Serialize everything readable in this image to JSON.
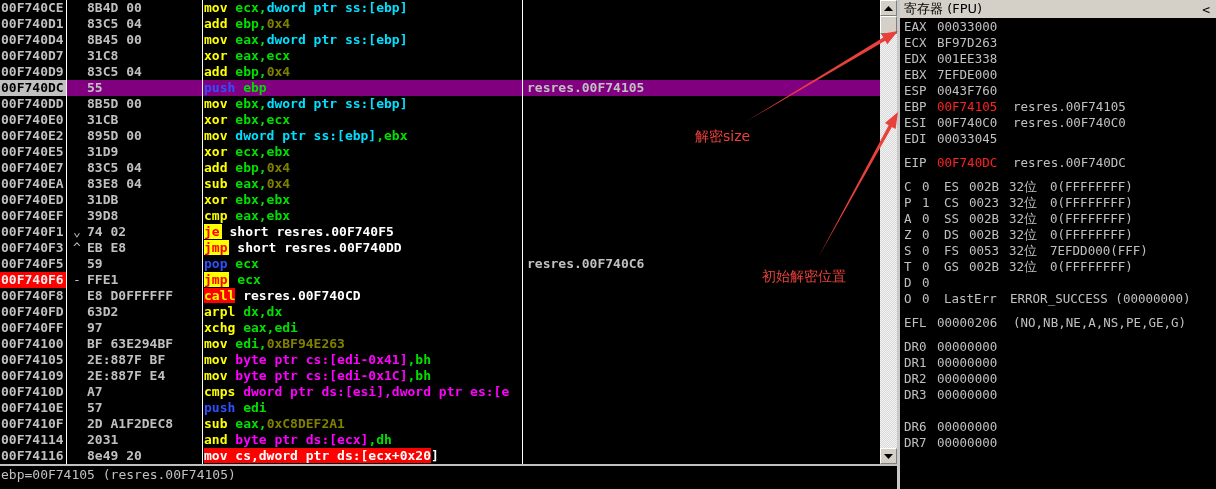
{
  "disassembly": {
    "rows": [
      {
        "address": "00F740CE",
        "jump_mark": "",
        "hex": "8B4D 00",
        "tokens": [
          {
            "kind": "mnemonic",
            "text": "mov"
          },
          {
            "kind": "register",
            "text": "ecx,"
          },
          {
            "kind": "stack_memory",
            "text": "dword ptr ss:[ebp]"
          }
        ],
        "comment": "",
        "selected": false,
        "breakpoint": false
      },
      {
        "address": "00F740D1",
        "jump_mark": "",
        "hex": "83C5 04",
        "tokens": [
          {
            "kind": "mnemonic",
            "text": "add"
          },
          {
            "kind": "register",
            "text": "ebp,"
          },
          {
            "kind": "constant",
            "text": "0x4"
          }
        ],
        "comment": "",
        "selected": false,
        "breakpoint": false
      },
      {
        "address": "00F740D4",
        "jump_mark": "",
        "hex": "8B45 00",
        "tokens": [
          {
            "kind": "mnemonic",
            "text": "mov"
          },
          {
            "kind": "register",
            "text": "eax,"
          },
          {
            "kind": "stack_memory",
            "text": "dword ptr ss:[ebp]"
          }
        ],
        "comment": "",
        "selected": false,
        "breakpoint": false
      },
      {
        "address": "00F740D7",
        "jump_mark": "",
        "hex": "31C8",
        "tokens": [
          {
            "kind": "mnemonic",
            "text": "xor"
          },
          {
            "kind": "register",
            "text": "eax,ecx"
          }
        ],
        "comment": "",
        "selected": false,
        "breakpoint": false
      },
      {
        "address": "00F740D9",
        "jump_mark": "",
        "hex": "83C5 04",
        "tokens": [
          {
            "kind": "mnemonic",
            "text": "add"
          },
          {
            "kind": "register",
            "text": "ebp,"
          },
          {
            "kind": "constant",
            "text": "0x4"
          }
        ],
        "comment": "",
        "selected": false,
        "breakpoint": false
      },
      {
        "address": "00F740DC",
        "jump_mark": "",
        "hex": "55",
        "tokens": [
          {
            "kind": "stack_op",
            "text": "push"
          },
          {
            "kind": "register",
            "text": "ebp"
          }
        ],
        "comment": "resres.00F74105",
        "selected": true,
        "breakpoint": false
      },
      {
        "address": "00F740DD",
        "jump_mark": "",
        "hex": "8B5D 00",
        "tokens": [
          {
            "kind": "mnemonic",
            "text": "mov"
          },
          {
            "kind": "register",
            "text": "ebx,"
          },
          {
            "kind": "stack_memory",
            "text": "dword ptr ss:[ebp]"
          }
        ],
        "comment": "",
        "selected": false,
        "breakpoint": false
      },
      {
        "address": "00F740E0",
        "jump_mark": "",
        "hex": "31CB",
        "tokens": [
          {
            "kind": "mnemonic",
            "text": "xor"
          },
          {
            "kind": "register",
            "text": "ebx,ecx"
          }
        ],
        "comment": "",
        "selected": false,
        "breakpoint": false
      },
      {
        "address": "00F740E2",
        "jump_mark": "",
        "hex": "895D 00",
        "tokens": [
          {
            "kind": "mnemonic",
            "text": "mov"
          },
          {
            "kind": "stack_memory",
            "text": "dword ptr ss:[ebp]"
          },
          {
            "kind": "register",
            "text": ",ebx"
          }
        ],
        "comment": "",
        "selected": false,
        "breakpoint": false
      },
      {
        "address": "00F740E5",
        "jump_mark": "",
        "hex": "31D9",
        "tokens": [
          {
            "kind": "mnemonic",
            "text": "xor"
          },
          {
            "kind": "register",
            "text": "ecx,ebx"
          }
        ],
        "comment": "",
        "selected": false,
        "breakpoint": false
      },
      {
        "address": "00F740E7",
        "jump_mark": "",
        "hex": "83C5 04",
        "tokens": [
          {
            "kind": "mnemonic",
            "text": "add"
          },
          {
            "kind": "register",
            "text": "ebp,"
          },
          {
            "kind": "constant",
            "text": "0x4"
          }
        ],
        "comment": "",
        "selected": false,
        "breakpoint": false
      },
      {
        "address": "00F740EA",
        "jump_mark": "",
        "hex": "83E8 04",
        "tokens": [
          {
            "kind": "mnemonic",
            "text": "sub"
          },
          {
            "kind": "register",
            "text": "eax,"
          },
          {
            "kind": "constant",
            "text": "0x4"
          }
        ],
        "comment": "",
        "selected": false,
        "breakpoint": false
      },
      {
        "address": "00F740ED",
        "jump_mark": "",
        "hex": "31DB",
        "tokens": [
          {
            "kind": "mnemonic",
            "text": "xor"
          },
          {
            "kind": "register",
            "text": "ebx,ebx"
          }
        ],
        "comment": "",
        "selected": false,
        "breakpoint": false
      },
      {
        "address": "00F740EF",
        "jump_mark": "",
        "hex": "39D8",
        "tokens": [
          {
            "kind": "mnemonic",
            "text": "cmp"
          },
          {
            "kind": "register",
            "text": "eax,ebx"
          }
        ],
        "comment": "",
        "selected": false,
        "breakpoint": false
      },
      {
        "address": "00F740F1",
        "jump_mark": "⌄",
        "hex": "74 02",
        "tokens": [
          {
            "kind": "jump",
            "text": "je"
          },
          {
            "kind": "plain",
            "text": "short resres.00F740F5"
          }
        ],
        "comment": "",
        "selected": false,
        "breakpoint": false
      },
      {
        "address": "00F740F3",
        "jump_mark": "^",
        "hex": "EB E8",
        "tokens": [
          {
            "kind": "jump",
            "text": "jmp"
          },
          {
            "kind": "plain",
            "text": "short resres.00F740DD"
          }
        ],
        "comment": "",
        "selected": false,
        "breakpoint": false
      },
      {
        "address": "00F740F5",
        "jump_mark": "",
        "hex": "59",
        "tokens": [
          {
            "kind": "stack_op",
            "text": "pop"
          },
          {
            "kind": "register",
            "text": "ecx"
          }
        ],
        "comment": "resres.00F740C6",
        "selected": false,
        "breakpoint": false
      },
      {
        "address": "00F740F6",
        "jump_mark": "-",
        "hex": "FFE1",
        "tokens": [
          {
            "kind": "jump",
            "text": "jmp"
          },
          {
            "kind": "register",
            "text": "ecx"
          }
        ],
        "comment": "",
        "selected": false,
        "breakpoint": true
      },
      {
        "address": "00F740F8",
        "jump_mark": "",
        "hex": "E8 D0FFFFFF",
        "tokens": [
          {
            "kind": "call",
            "text": "call"
          },
          {
            "kind": "plain",
            "text": "resres.00F740CD"
          }
        ],
        "comment": "",
        "selected": false,
        "breakpoint": false
      },
      {
        "address": "00F740FD",
        "jump_mark": "",
        "hex": "63D2",
        "tokens": [
          {
            "kind": "mnemonic",
            "text": "arpl"
          },
          {
            "kind": "register",
            "text": "dx,dx"
          }
        ],
        "comment": "",
        "selected": false,
        "breakpoint": false
      },
      {
        "address": "00F740FF",
        "jump_mark": "",
        "hex": "97",
        "tokens": [
          {
            "kind": "mnemonic",
            "text": "xchg"
          },
          {
            "kind": "register",
            "text": "eax,edi"
          }
        ],
        "comment": "",
        "selected": false,
        "breakpoint": false
      },
      {
        "address": "00F74100",
        "jump_mark": "",
        "hex": "BF 63E294BF",
        "tokens": [
          {
            "kind": "mnemonic",
            "text": "mov"
          },
          {
            "kind": "register",
            "text": "edi,"
          },
          {
            "kind": "constant",
            "text": "0xBF94E263"
          }
        ],
        "comment": "",
        "selected": false,
        "breakpoint": false
      },
      {
        "address": "00F74105",
        "jump_mark": "",
        "hex": "2E:887F BF",
        "tokens": [
          {
            "kind": "mnemonic",
            "text": "mov"
          },
          {
            "kind": "memory",
            "text": "byte ptr cs:[edi-0x41]"
          },
          {
            "kind": "register",
            "text": ",bh"
          }
        ],
        "comment": "",
        "selected": false,
        "breakpoint": false
      },
      {
        "address": "00F74109",
        "jump_mark": "",
        "hex": "2E:887F E4",
        "tokens": [
          {
            "kind": "mnemonic",
            "text": "mov"
          },
          {
            "kind": "memory",
            "text": "byte ptr cs:[edi-0x1C]"
          },
          {
            "kind": "register",
            "text": ",bh"
          }
        ],
        "comment": "",
        "selected": false,
        "breakpoint": false
      },
      {
        "address": "00F7410D",
        "jump_mark": "",
        "hex": "A7",
        "tokens": [
          {
            "kind": "mnemonic",
            "text": "cmps"
          },
          {
            "kind": "memory",
            "text": "dword ptr ds:[esi],dword ptr es:[e"
          }
        ],
        "comment": "",
        "selected": false,
        "breakpoint": false
      },
      {
        "address": "00F7410E",
        "jump_mark": "",
        "hex": "57",
        "tokens": [
          {
            "kind": "stack_op",
            "text": "push"
          },
          {
            "kind": "register",
            "text": "edi"
          }
        ],
        "comment": "",
        "selected": false,
        "breakpoint": false
      },
      {
        "address": "00F7410F",
        "jump_mark": "",
        "hex": "2D A1F2DEC8",
        "tokens": [
          {
            "kind": "mnemonic",
            "text": "sub"
          },
          {
            "kind": "register",
            "text": "eax,"
          },
          {
            "kind": "constant",
            "text": "0xC8DEF2A1"
          }
        ],
        "comment": "",
        "selected": false,
        "breakpoint": false
      },
      {
        "address": "00F74114",
        "jump_mark": "",
        "hex": "2031",
        "tokens": [
          {
            "kind": "mnemonic",
            "text": "and"
          },
          {
            "kind": "memory",
            "text": "byte ptr ds:[ecx]"
          },
          {
            "kind": "register",
            "text": ",dh"
          }
        ],
        "comment": "",
        "selected": false,
        "breakpoint": false
      },
      {
        "address": "00F74116",
        "jump_mark": "",
        "hex": "8e49 20",
        "tokens": [
          {
            "kind": "invalid",
            "text": "mov"
          },
          {
            "kind": "invalid",
            "text": "cs,dword ptr ds:[ecx+0x20"
          },
          {
            "kind": "plain",
            "text": "]"
          }
        ],
        "comment": "",
        "selected": false,
        "breakpoint": false
      }
    ]
  },
  "status_bar": "ebp=00F74105 (resres.00F74105)",
  "registers": {
    "title": "寄存器 (FPU)",
    "collapse": "<",
    "groups": [
      {
        "lines": [
          {
            "kind": "register",
            "name": "EAX",
            "value": "00033000",
            "changed": false
          },
          {
            "kind": "register",
            "name": "ECX",
            "value": "BF97D263",
            "changed": false
          },
          {
            "kind": "register",
            "name": "EDX",
            "value": "001EE338",
            "changed": false
          },
          {
            "kind": "register",
            "name": "EBX",
            "value": "7EFDE000",
            "changed": false
          },
          {
            "kind": "register",
            "name": "ESP",
            "value": "0043F760",
            "changed": false
          },
          {
            "kind": "register",
            "name": "EBP",
            "value": "00F74105",
            "changed": true,
            "comment": "resres.00F74105"
          },
          {
            "kind": "register",
            "name": "ESI",
            "value": "00F740C0",
            "changed": false,
            "comment": "resres.00F740C0"
          },
          {
            "kind": "register",
            "name": "EDI",
            "value": "00033045",
            "changed": false
          }
        ]
      },
      {
        "lines": [
          {
            "kind": "register",
            "name": "EIP",
            "value": "00F740DC",
            "changed": true,
            "comment": "resres.00F740DC"
          }
        ]
      },
      {
        "lines": [
          {
            "kind": "flag",
            "flag": "C",
            "value": "0",
            "segment": "ES",
            "selector": "002B",
            "bits": "32位",
            "base": "0(FFFFFFFF)"
          },
          {
            "kind": "flag",
            "flag": "P",
            "value": "1",
            "segment": "CS",
            "selector": "0023",
            "bits": "32位",
            "base": "0(FFFFFFFF)"
          },
          {
            "kind": "flag",
            "flag": "A",
            "value": "0",
            "segment": "SS",
            "selector": "002B",
            "bits": "32位",
            "base": "0(FFFFFFFF)"
          },
          {
            "kind": "flag",
            "flag": "Z",
            "value": "0",
            "segment": "DS",
            "selector": "002B",
            "bits": "32位",
            "base": "0(FFFFFFFF)"
          },
          {
            "kind": "flag",
            "flag": "S",
            "value": "0",
            "segment": "FS",
            "selector": "0053",
            "bits": "32位",
            "base": "7EFDD000(FFF)"
          },
          {
            "kind": "flag",
            "flag": "T",
            "value": "0",
            "segment": "GS",
            "selector": "002B",
            "bits": "32位",
            "base": "0(FFFFFFFF)"
          },
          {
            "kind": "flag",
            "flag": "D",
            "value": "0"
          },
          {
            "kind": "lasterr",
            "flag": "O",
            "value": "0",
            "label": "LastErr",
            "error": "ERROR_SUCCESS (00000000)"
          }
        ]
      },
      {
        "lines": [
          {
            "kind": "register",
            "name": "EFL",
            "value": "00000206",
            "changed": false,
            "comment": "(NO,NB,NE,A,NS,PE,GE,G)"
          }
        ]
      },
      {
        "lines": [
          {
            "kind": "register",
            "name": "DR0",
            "value": "00000000",
            "changed": false
          },
          {
            "kind": "register",
            "name": "DR1",
            "value": "00000000",
            "changed": false
          },
          {
            "kind": "register",
            "name": "DR2",
            "value": "00000000",
            "changed": false
          },
          {
            "kind": "register",
            "name": "DR3",
            "value": "00000000",
            "changed": false
          }
        ]
      },
      {
        "lines": [
          {
            "kind": "register",
            "name": "DR6",
            "value": "00000000",
            "changed": false
          },
          {
            "kind": "register",
            "name": "DR7",
            "value": "00000000",
            "changed": false
          }
        ]
      }
    ]
  },
  "annotations": [
    {
      "text": "解密size"
    },
    {
      "text": "初始解密位置"
    }
  ]
}
